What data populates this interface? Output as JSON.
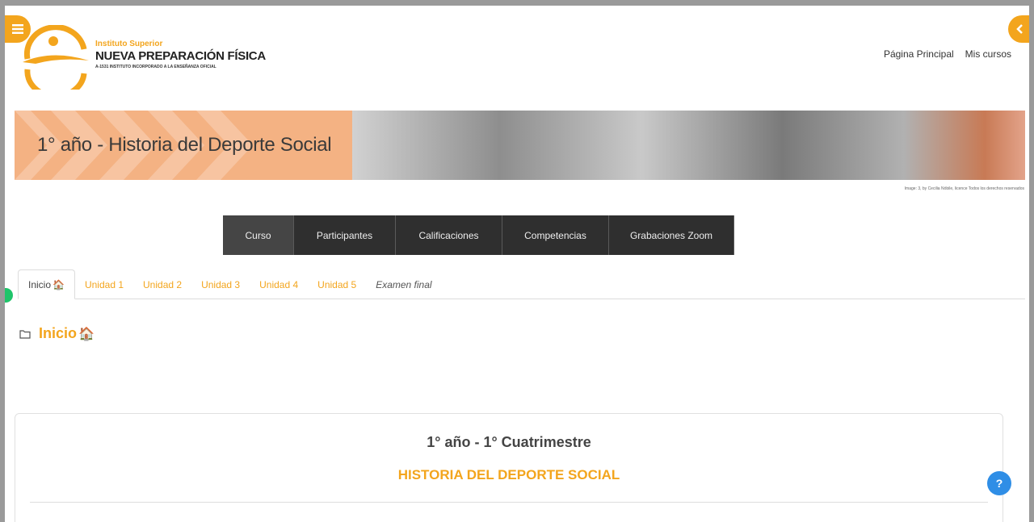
{
  "logo": {
    "line1": "Instituto Superior",
    "line2": "NUEVA PREPARACIÓN FÍSICA",
    "line3": "A-1531  INSTITUTO INCORPORADO A LA ENSEÑANZA OFICIAL"
  },
  "header": {
    "nav": [
      "Página Principal",
      "Mis cursos"
    ]
  },
  "banner": {
    "title": "1° año - Historia del Deporte Social",
    "credit": "Image: 3, by Cecilia Nóbile, licence Todos los derechos reservados"
  },
  "course_nav": [
    {
      "label": "Curso",
      "active": true
    },
    {
      "label": "Participantes",
      "active": false
    },
    {
      "label": "Calificaciones",
      "active": false
    },
    {
      "label": "Competencias",
      "active": false
    },
    {
      "label": "Grabaciones Zoom",
      "active": false
    }
  ],
  "tabs": [
    {
      "label": "Inicio",
      "icon": "house-icon",
      "active": true
    },
    {
      "label": "Unidad 1"
    },
    {
      "label": "Unidad 2"
    },
    {
      "label": "Unidad 3"
    },
    {
      "label": "Unidad 4"
    },
    {
      "label": "Unidad 5"
    },
    {
      "label": "Examen final"
    }
  ],
  "section": {
    "title": "Inicio",
    "icon": "folder-icon"
  },
  "card": {
    "subtitle": "1° año - 1° Cuatrimestre",
    "title": "HISTORIA DEL DEPORTE SOCIAL"
  },
  "help": {
    "label": "?"
  },
  "colors": {
    "accent": "#f3a51d",
    "nav_dark": "#2f2f2f",
    "banner_peach": "#f4b283",
    "help_blue": "#2f8ee6"
  }
}
